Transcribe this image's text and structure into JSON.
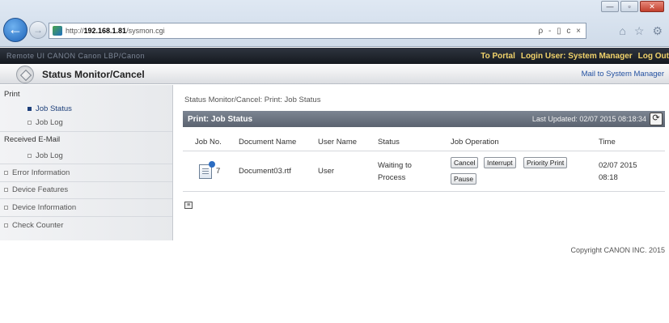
{
  "browser": {
    "url_prefix": "http://",
    "url_host": "192.168.1.81",
    "url_path": "/sysmon.cgi",
    "address_tools": "ρ - ▯ c ×",
    "win_min": "—",
    "win_max": "▫",
    "win_close": "✕"
  },
  "header": {
    "left_text": "Remote UI  CANON Canon LBP/Canon",
    "portal_link": "To Portal",
    "login_label": "Login User:",
    "login_user": "System Manager",
    "logout_link": "Log Out"
  },
  "titlebar": {
    "title": "Status Monitor/Cancel",
    "mail_link": "Mail to System Manager"
  },
  "sidebar": {
    "sections": [
      {
        "label": "Print"
      },
      {
        "label": "Received E-Mail"
      }
    ],
    "items": [
      {
        "label": "Job Status",
        "active": true
      },
      {
        "label": "Job Log"
      },
      {
        "label": "Job Log"
      },
      {
        "label": "Error Information"
      },
      {
        "label": "Device Features"
      },
      {
        "label": "Device Information"
      },
      {
        "label": "Check Counter"
      }
    ]
  },
  "main": {
    "breadcrumb": "Status Monitor/Cancel: Print: Job Status",
    "panel_title": "Print: Job Status",
    "last_updated_label": "Last Updated:",
    "last_updated_value": "02/07 2015 08:18:34",
    "refresh_icon": "⟳",
    "columns": [
      "Job No.",
      "Document Name",
      "User Name",
      "Status",
      "Job Operation",
      "Time"
    ],
    "rows": [
      {
        "job_no": "7",
        "document": "Document03.rtf",
        "user": "User",
        "status_line1": "Waiting to",
        "status_line2": "Process",
        "time_line1": "02/07 2015",
        "time_line2": "08:18",
        "operations": [
          "Cancel",
          "Interrupt",
          "Priority Print",
          "Pause"
        ]
      }
    ],
    "pager_icon": "≡"
  },
  "footer": {
    "copyright": "Copyright CANON INC. 2015"
  }
}
